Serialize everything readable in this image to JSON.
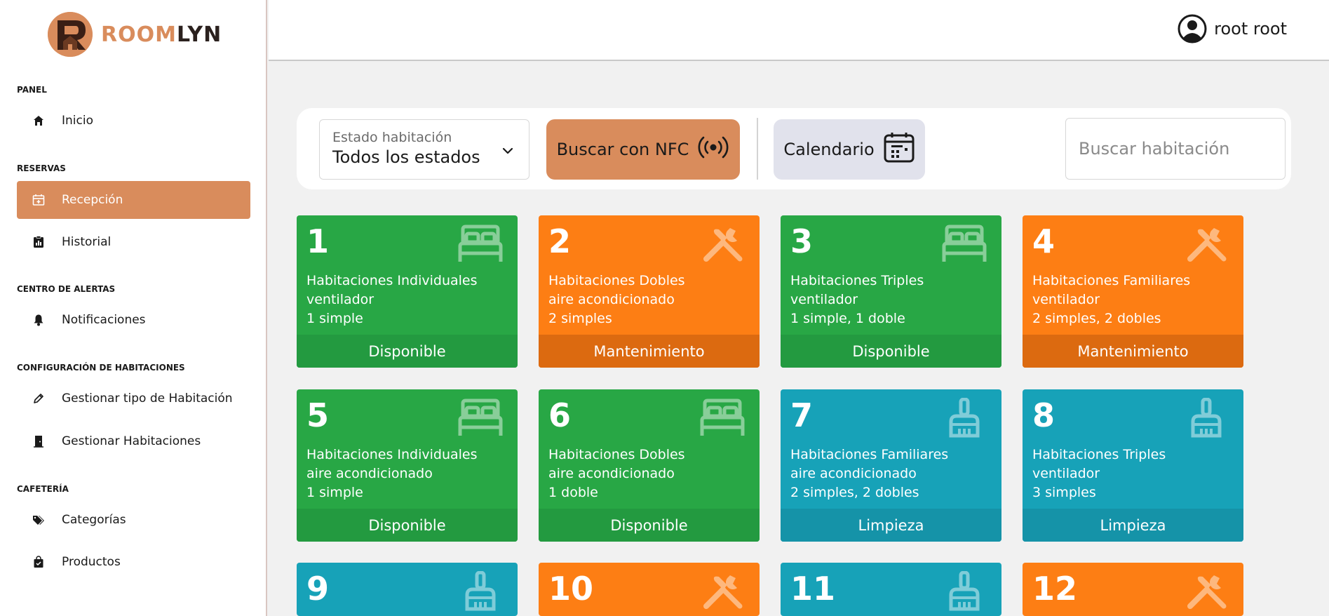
{
  "brand": {
    "name_a": "ROOM",
    "name_b": "LYN"
  },
  "user": {
    "name": "root root"
  },
  "sidebar": {
    "sections": [
      {
        "title": "PANEL"
      },
      {
        "title": "RESERVAS"
      },
      {
        "title": "CENTRO DE ALERTAS"
      },
      {
        "title": "CONFIGURACIÓN DE HABITACIONES"
      },
      {
        "title": "CAFETERÍA"
      }
    ],
    "items": [
      {
        "label": "Inicio",
        "icon": "home-icon"
      },
      {
        "label": "Recepción",
        "icon": "calendar-plus-icon",
        "active": true
      },
      {
        "label": "Historial",
        "icon": "clipboard-chart-icon"
      },
      {
        "label": "Notificaciones",
        "icon": "bell-icon"
      },
      {
        "label": "Gestionar tipo de Habitación",
        "icon": "pencil-icon"
      },
      {
        "label": "Gestionar Habitaciones",
        "icon": "door-icon"
      },
      {
        "label": "Categorías",
        "icon": "tags-icon"
      },
      {
        "label": "Productos",
        "icon": "bag-check-icon"
      }
    ]
  },
  "filters": {
    "status_label": "Estado habitación",
    "status_value": "Todos los estados",
    "nfc_label": "Buscar con NFC",
    "calendar_label": "Calendario",
    "search_placeholder": "Buscar habitación"
  },
  "colors": {
    "accent": "#d98c5c",
    "available": "#28a745",
    "maintenance": "#fd7e14",
    "cleaning": "#17a2b8"
  },
  "rooms": [
    {
      "number": "1",
      "type": "Habitaciones Individuales",
      "climate": "ventilador",
      "beds": "1 simple",
      "status": "Disponible",
      "icon": "bed-icon"
    },
    {
      "number": "2",
      "type": "Habitaciones Dobles",
      "climate": "aire acondicionado",
      "beds": "2 simples",
      "status": "Mantenimiento",
      "icon": "tools-icon"
    },
    {
      "number": "3",
      "type": "Habitaciones Triples",
      "climate": "ventilador",
      "beds": "1 simple, 1 doble",
      "status": "Disponible",
      "icon": "bed-icon"
    },
    {
      "number": "4",
      "type": "Habitaciones Familiares",
      "climate": "ventilador",
      "beds": "2 simples, 2 dobles",
      "status": "Mantenimiento",
      "icon": "tools-icon"
    },
    {
      "number": "5",
      "type": "Habitaciones Individuales",
      "climate": "aire acondicionado",
      "beds": "1 simple",
      "status": "Disponible",
      "icon": "bed-icon"
    },
    {
      "number": "6",
      "type": "Habitaciones Dobles",
      "climate": "aire acondicionado",
      "beds": "1 doble",
      "status": "Disponible",
      "icon": "bed-icon"
    },
    {
      "number": "7",
      "type": "Habitaciones Familiares",
      "climate": "aire acondicionado",
      "beds": "2 simples, 2 dobles",
      "status": "Limpieza",
      "icon": "broom-icon"
    },
    {
      "number": "8",
      "type": "Habitaciones Triples",
      "climate": "ventilador",
      "beds": "3 simples",
      "status": "Limpieza",
      "icon": "broom-icon"
    },
    {
      "number": "9",
      "icon": "broom-icon"
    },
    {
      "number": "10",
      "icon": "tools-icon"
    },
    {
      "number": "11",
      "icon": "broom-icon"
    },
    {
      "number": "12",
      "icon": "tools-icon"
    }
  ]
}
